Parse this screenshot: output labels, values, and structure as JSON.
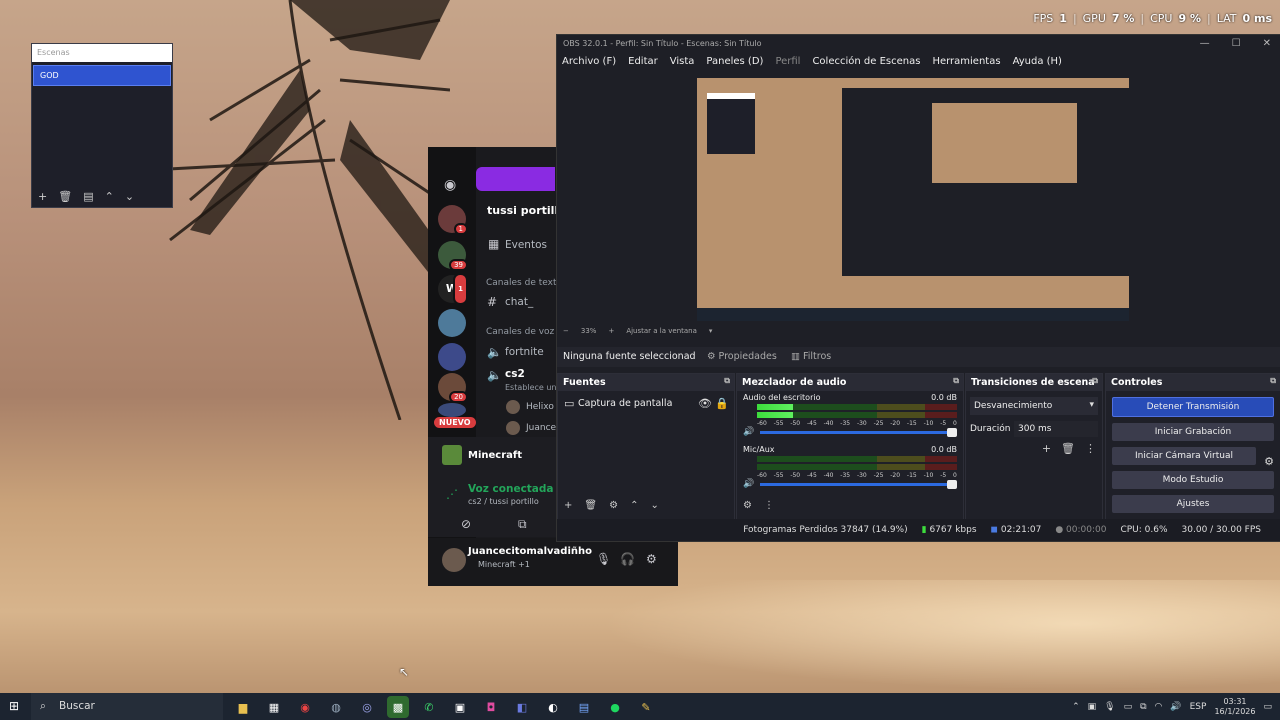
{
  "overlay": {
    "fps_label": "FPS",
    "fps_value": "1",
    "gpu_label": "GPU",
    "gpu_value": "7 %",
    "cpu_label": "CPU",
    "cpu_value": "9 %",
    "lat_label": "LAT",
    "lat_value": "0 ms"
  },
  "scenes_window": {
    "title": "Escenas",
    "items": [
      "GOD"
    ]
  },
  "discord": {
    "server_name": "tussi portillo",
    "events_label": "Eventos",
    "text_category": "Canales de texto",
    "text_channel": "chat_",
    "voice_category": "Canales de voz",
    "voice_channels": [
      "fortnite",
      "cs2"
    ],
    "cs2_subtitle": "Establece un e",
    "voice_members": [
      "Helixo",
      "Juance"
    ],
    "server_badges": [
      "1",
      "39",
      "1",
      "20"
    ],
    "nuevo_label": "NUEVO",
    "activity_game": "Minecraft",
    "voice_status": "Voz conectada",
    "voice_location": "cs2 / tussi portillo",
    "username": "Juancecitomalvadiñho",
    "user_status": "Minecraft +1"
  },
  "obs": {
    "title": "OBS 32.0.1 - Perfil: Sin Título - Escenas: Sin Título",
    "menu": [
      "Archivo (F)",
      "Editar",
      "Vista",
      "Paneles (D)",
      "Perfil",
      "Colección de Escenas",
      "Herramientas",
      "Ayuda (H)"
    ],
    "zoom": "33%",
    "fit_label": "Ajustar a la ventana",
    "no_source": "Ninguna fuente seleccionad",
    "properties_label": "Propiedades",
    "filters_label": "Filtros",
    "sources_title": "Fuentes",
    "source_item": "Captura de pantalla",
    "mixer_title": "Mezclador de audio",
    "mixer_channels": [
      {
        "name": "Audio del escritorio",
        "db": "0.0 dB",
        "level": 0.18
      },
      {
        "name": "Mic/Aux",
        "db": "0.0 dB",
        "level": 0.0
      }
    ],
    "meter_scale": [
      "-60",
      "-55",
      "-50",
      "-45",
      "-40",
      "-35",
      "-30",
      "-25",
      "-20",
      "-15",
      "-10",
      "-5",
      "0"
    ],
    "transitions_title": "Transiciones de escena",
    "transition_value": "Desvanecimiento",
    "duration_label": "Duración",
    "duration_value": "300 ms",
    "controls_title": "Controles",
    "controls": [
      "Detener Transmisión",
      "Iniciar Grabación",
      "Iniciar Cámara Virtual",
      "Modo Estudio",
      "Ajustes"
    ],
    "status": {
      "dropped": "Fotogramas Perdidos 37847 (14.9%)",
      "bitrate": "6767 kbps",
      "stream_time": "02:21:07",
      "rec_time": "00:00:00",
      "cpu": "CPU: 0.6%",
      "fps": "30.00 / 30.00 FPS"
    }
  },
  "taskbar": {
    "search_placeholder": "Buscar",
    "lang": "ESP",
    "time": "03:31",
    "date": "16/1/2026"
  }
}
